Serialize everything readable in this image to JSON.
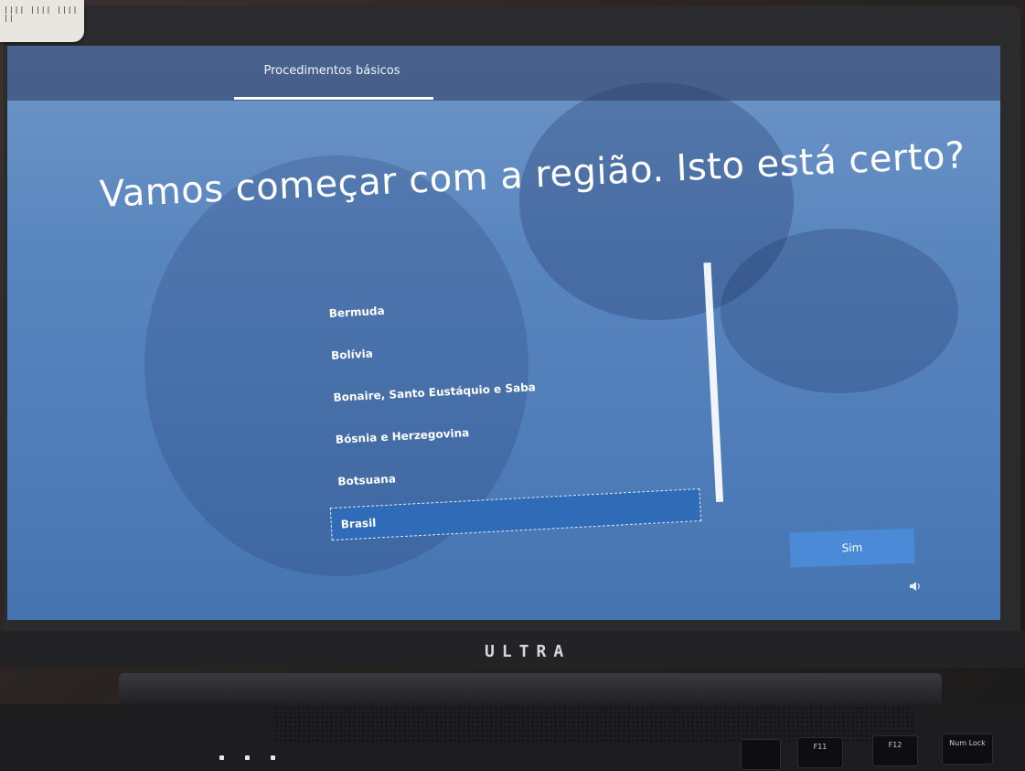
{
  "sticker": {
    "text": "|||| |||| |||| ||"
  },
  "header": {
    "tab_label": "Procedimentos básicos"
  },
  "main": {
    "heading": "Vamos começar com a região. Isto está certo?",
    "regions": [
      {
        "label": "Bermuda",
        "selected": false
      },
      {
        "label": "Bolívia",
        "selected": false
      },
      {
        "label": "Bonaire, Santo Eustáquio e Saba",
        "selected": false
      },
      {
        "label": "Bósnia e Herzegovina",
        "selected": false
      },
      {
        "label": "Botsuana",
        "selected": false
      },
      {
        "label": "Brasil",
        "selected": true
      }
    ],
    "confirm_label": "Sim"
  },
  "laptop": {
    "brand": "ULTRA",
    "keys": {
      "f11": "F11",
      "f12": "F12",
      "num_lock": "Num Lock"
    }
  },
  "colors": {
    "screen_bg": "#5a86bf",
    "selected_bg": "#2f6bb7",
    "button_bg": "#4a8ad6",
    "text": "#ffffff"
  },
  "icons": {
    "ease_of_access": "ease-of-access-icon",
    "volume": "volume-icon"
  }
}
